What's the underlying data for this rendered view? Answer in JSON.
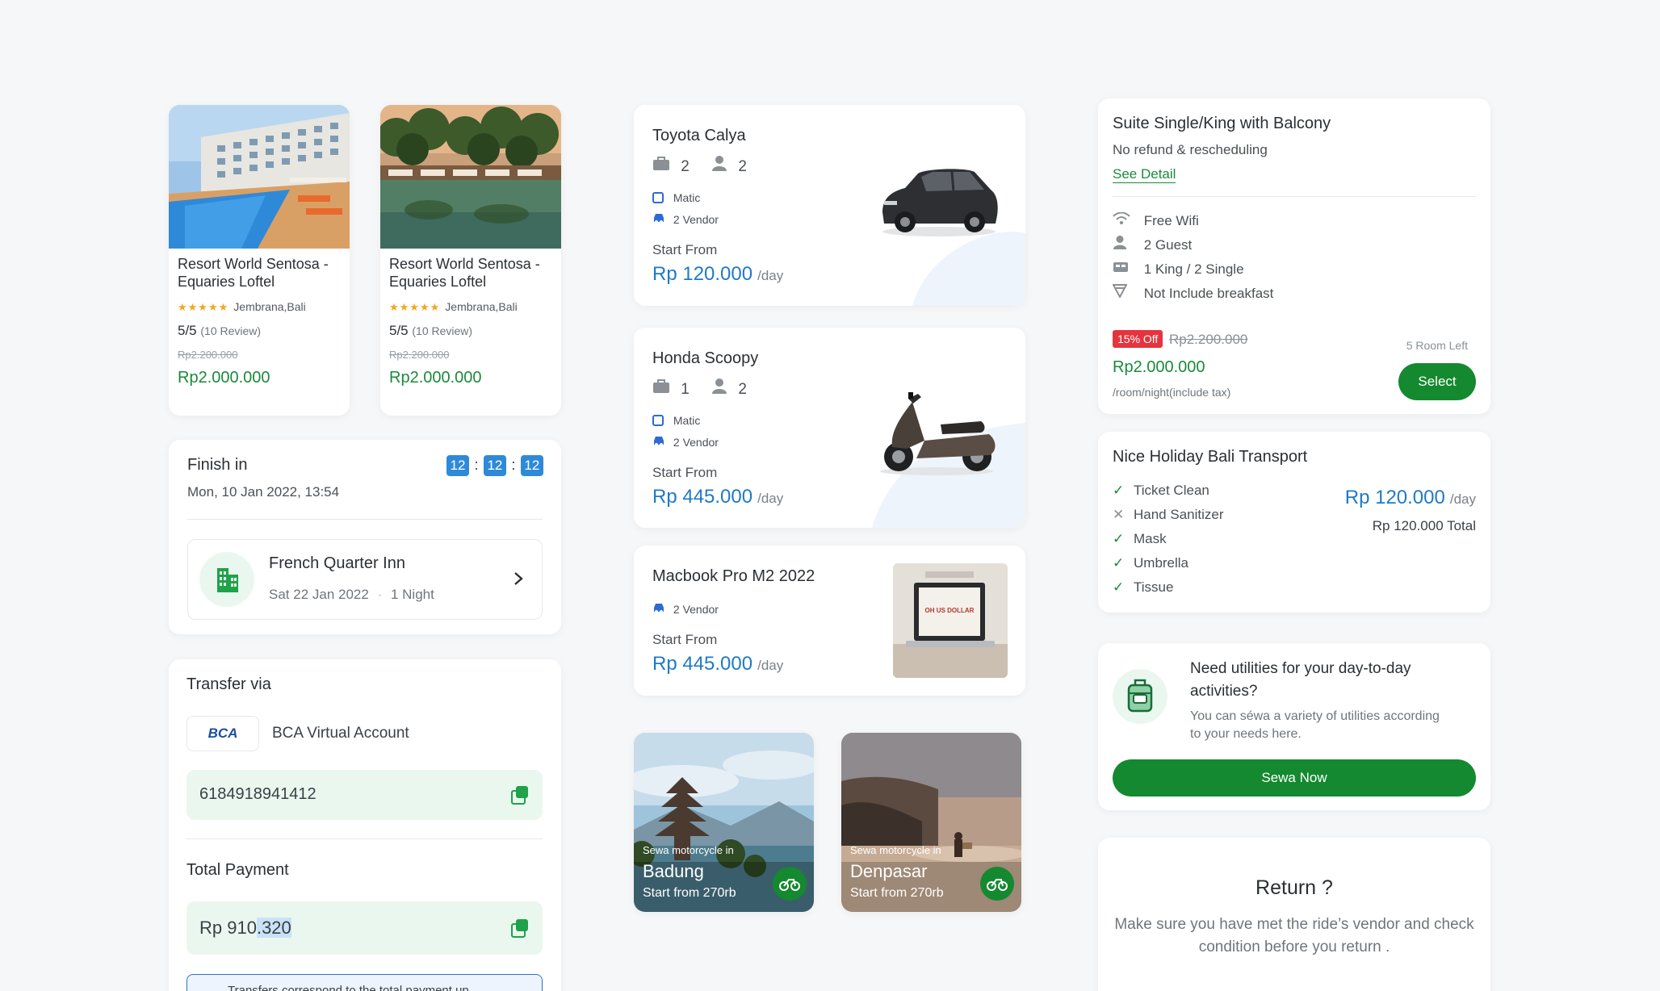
{
  "hotels": [
    {
      "name": "Resort World Sentosa - Equaries Loftel",
      "stars": "★★★★★",
      "location": "Jembrana,Bali",
      "rating": "5/5",
      "reviews": "(10 Review)",
      "old_price": "Rp2.200.000",
      "price": "Rp2.000.000"
    },
    {
      "name": "Resort World Sentosa - Equaries Loftel",
      "stars": "★★★★★",
      "location": "Jembrana,Bali",
      "rating": "5/5",
      "reviews": "(10 Review)",
      "old_price": "Rp2.200.000",
      "price": "Rp2.000.000"
    }
  ],
  "booking": {
    "finish_label": "Finish in",
    "datetime": "Mon, 10 Jan 2022, 13:54",
    "timer": [
      "12",
      "12",
      "12"
    ],
    "timer_sep": ":",
    "hotel_name": "French Quarter Inn",
    "hotel_date": "Sat 22 Jan 2022",
    "hotel_nights": "1 Night"
  },
  "payment": {
    "transfer_label": "Transfer via",
    "bank_logo": "BCA",
    "bank_name": "BCA Virtual Account",
    "account_number": "6184918941412",
    "total_label": "Total Payment",
    "total_prefix": "Rp 910",
    "total_highlight": ".320",
    "note": "Transfers correspond to the total payment up"
  },
  "vehicles": [
    {
      "name": "Toyota Calya",
      "bags": "2",
      "seats": "2",
      "transmission": "Matic",
      "vendor": "2 Vendor",
      "start_label": "Start From",
      "price": "Rp 120.000",
      "unit": "/day"
    },
    {
      "name": "Honda Scoopy",
      "bags": "1",
      "seats": "2",
      "transmission": "Matic",
      "vendor": "2 Vendor",
      "start_label": "Start From",
      "price": "Rp 445.000",
      "unit": "/day"
    }
  ],
  "laptop": {
    "name": "Macbook Pro M2 2022",
    "vendor": "2 Vendor",
    "start_label": "Start From",
    "price": "Rp 445.000",
    "unit": "/day",
    "screen_text": "OH US DOLLAR"
  },
  "destinations": [
    {
      "caption": "Sewa motorcycle in",
      "city": "Badung",
      "start": "Start from 270rb"
    },
    {
      "caption": "Sewa motorcycle in",
      "city": "Denpasar",
      "start": "Start from 270rb"
    }
  ],
  "room": {
    "title": "Suite Single/King with Balcony",
    "policy": "No refund & rescheduling",
    "detail_link": "See Detail",
    "features": [
      "Free Wifi",
      "2 Guest",
      "1 King / 2 Single",
      "Not Include breakfast"
    ],
    "discount": "15% Off",
    "old_price": "Rp2.200.000",
    "rooms_left": "5 Room Left",
    "price": "Rp2.000.000",
    "price_note": "/room/night(include tax)",
    "select_label": "Select"
  },
  "transport": {
    "title": "Nice Holiday Bali Transport",
    "items": [
      {
        "label": "Ticket Clean",
        "included": true
      },
      {
        "label": "Hand Sanitizer",
        "included": false
      },
      {
        "label": "Mask",
        "included": true
      },
      {
        "label": "Umbrella",
        "included": true
      },
      {
        "label": "Tissue",
        "included": true
      }
    ],
    "check_glyph": "✓",
    "cross_glyph": "✕",
    "price": "Rp 120.000",
    "unit": "/day",
    "total": "Rp 120.000 Total"
  },
  "utilities": {
    "title": "Need utilities for your day-to-day activities?",
    "body": "You can séwa a variety of utilities according to your needs here.",
    "button": "Sewa Now"
  },
  "return_card": {
    "title": "Return ?",
    "body": "Make sure you have met the ride’s vendor and check  condition before you return ."
  },
  "colors": {
    "green": "#14892f",
    "blue": "#1f7ac6",
    "discount_red": "#e5343d",
    "timer_blue": "#2e8ad8"
  }
}
